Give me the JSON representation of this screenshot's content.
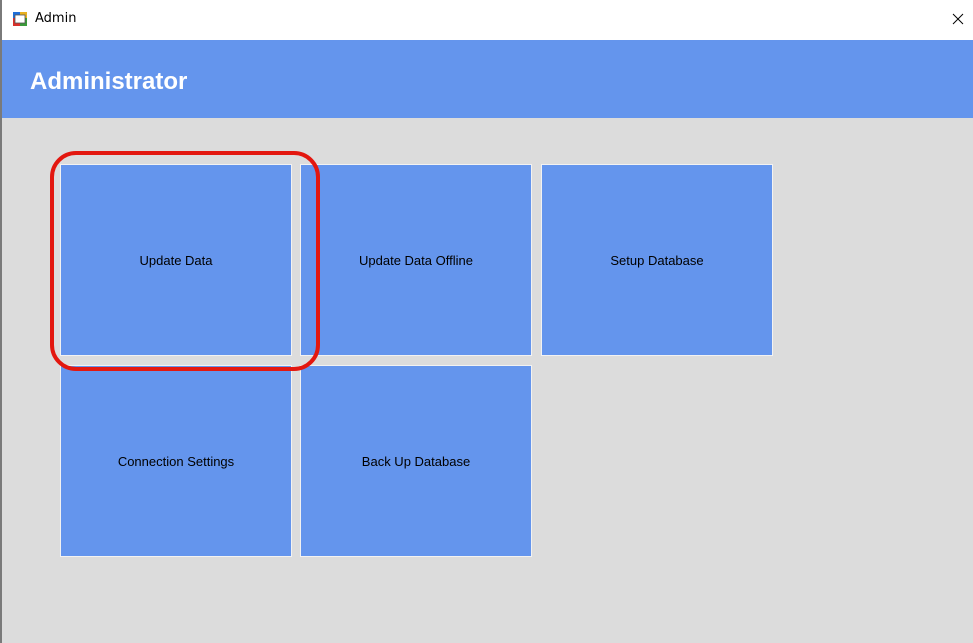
{
  "window": {
    "title": "Admin",
    "icon": "app-window-icon",
    "close_icon": "close-icon"
  },
  "header": {
    "title": "Administrator",
    "color": "#6495ed"
  },
  "tiles": [
    {
      "label": "Update Data"
    },
    {
      "label": "Update Data Offline"
    },
    {
      "label": "Setup Database"
    },
    {
      "label": "Connection Settings"
    },
    {
      "label": "Back Up Database"
    }
  ],
  "colors": {
    "tile": "#6495ed",
    "background": "#dcdcdc",
    "highlight": "#e3170f"
  }
}
